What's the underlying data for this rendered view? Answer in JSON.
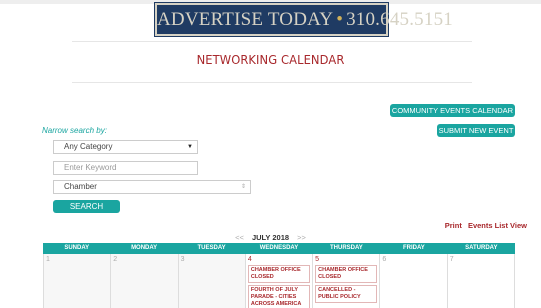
{
  "ad": {
    "text": "ADVERTISE TODAY",
    "separator": "•",
    "phone": "310.645.5151"
  },
  "page": {
    "title": "NETWORKING CALENDAR"
  },
  "buttons": {
    "community_events": "COMMUNITY EVENTS CALENDAR",
    "submit_event": "SUBMIT NEW EVENT",
    "search": "SEARCH"
  },
  "search": {
    "narrow_label": "Narrow search by:",
    "category": {
      "selected": "Any Category"
    },
    "keyword": {
      "placeholder": "Enter Keyword"
    },
    "chamber": {
      "selected": "Chamber"
    }
  },
  "links": {
    "print": "Print",
    "events_list_view": "Events List View"
  },
  "month_nav": {
    "prev": "<<",
    "label": "JULY 2018",
    "next": ">>"
  },
  "calendar": {
    "days": [
      "SUNDAY",
      "MONDAY",
      "TUESDAY",
      "WEDNESDAY",
      "THURSDAY",
      "FRIDAY",
      "SATURDAY"
    ],
    "cells": [
      {
        "day": "1",
        "events": []
      },
      {
        "day": "2",
        "events": []
      },
      {
        "day": "3",
        "events": []
      },
      {
        "day": "4",
        "events": [
          "CHAMBER OFFICE CLOSED",
          "FOURTH OF JULY PARADE - CITIES ACROSS AMERICA"
        ]
      },
      {
        "day": "5",
        "events": [
          "CHAMBER OFFICE CLOSED",
          "CANCELLED - PUBLIC POLICY"
        ]
      },
      {
        "day": "6",
        "events": []
      },
      {
        "day": "7",
        "events": []
      }
    ]
  },
  "colors": {
    "teal": "#1aa5a0",
    "red": "#a8282c",
    "navy": "#1f3b63"
  }
}
